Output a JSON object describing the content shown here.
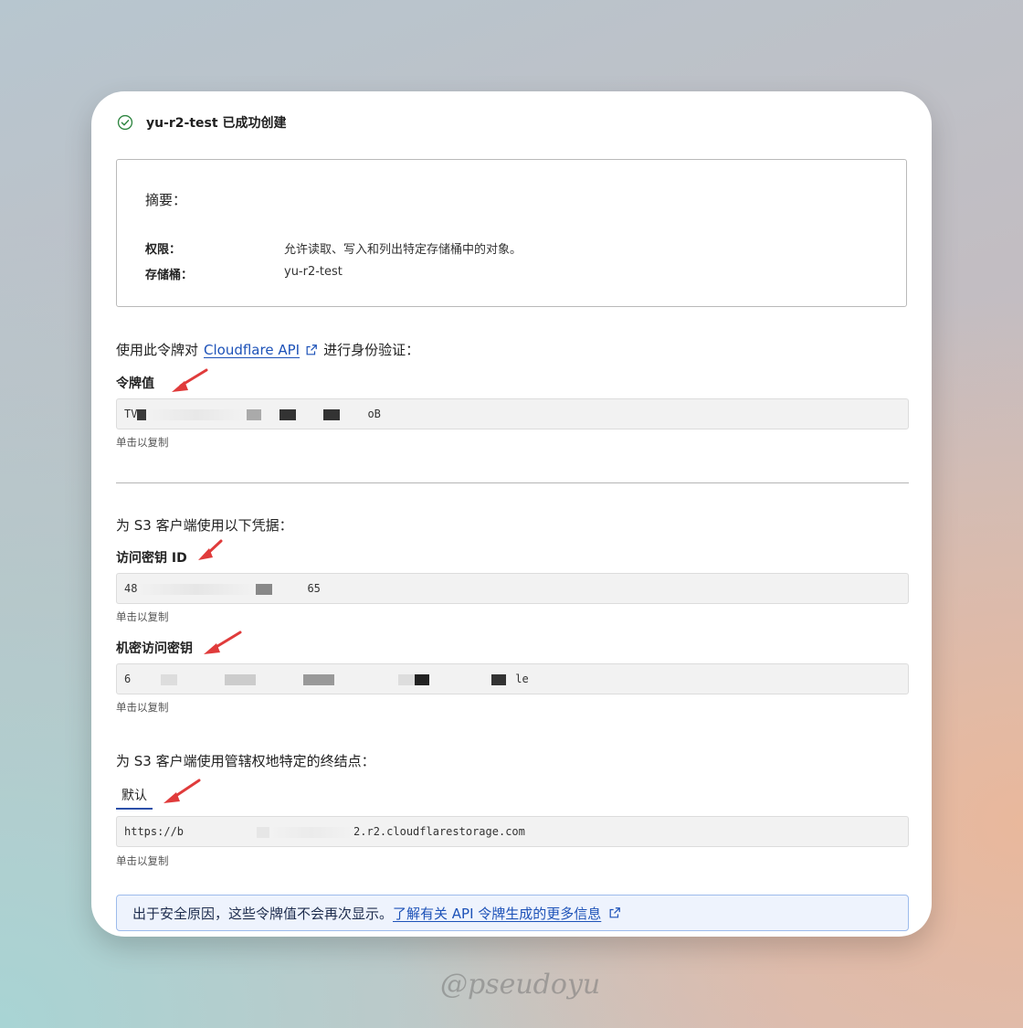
{
  "header": {
    "title": "yu-r2-test 已成功创建",
    "icon": "check-circle-icon"
  },
  "summary": {
    "title": "摘要：",
    "rows": [
      {
        "label": "权限：",
        "value": "允许读取、写入和列出特定存储桶中的对象。"
      },
      {
        "label": "存储桶：",
        "value": "yu-r2-test"
      }
    ]
  },
  "api_section": {
    "prefix": "使用此令牌对",
    "link": "Cloudflare API",
    "suffix": "进行身份验证："
  },
  "token": {
    "label": "令牌值",
    "visible_start": "TV",
    "visible_end": "oB",
    "hint": "单击以复制"
  },
  "s3_section": {
    "intro": "为 S3 客户端使用以下凭据："
  },
  "access_key": {
    "label": "访问密钥 ID",
    "visible_start": "48",
    "visible_end": "65",
    "hint": "单击以复制"
  },
  "secret_key": {
    "label": "机密访问密钥",
    "visible_start": "6",
    "visible_end": "le",
    "hint": "单击以复制"
  },
  "endpoint_section": {
    "intro": "为 S3 客户端使用管辖权地特定的终结点：",
    "tab": "默认",
    "visible_start": "https://b",
    "visible_end": "2.r2.cloudflarestorage.com",
    "hint": "单击以复制"
  },
  "notice": {
    "text": "出于安全原因，这些令牌值不会再次显示。",
    "link": "了解有关 API 令牌生成的更多信息"
  },
  "watermark": "@pseudoyu",
  "colors": {
    "link": "#1d52b8",
    "arrow": "#e03b3b",
    "tab_underline": "#2b4fa8",
    "check": "#2e8540"
  }
}
